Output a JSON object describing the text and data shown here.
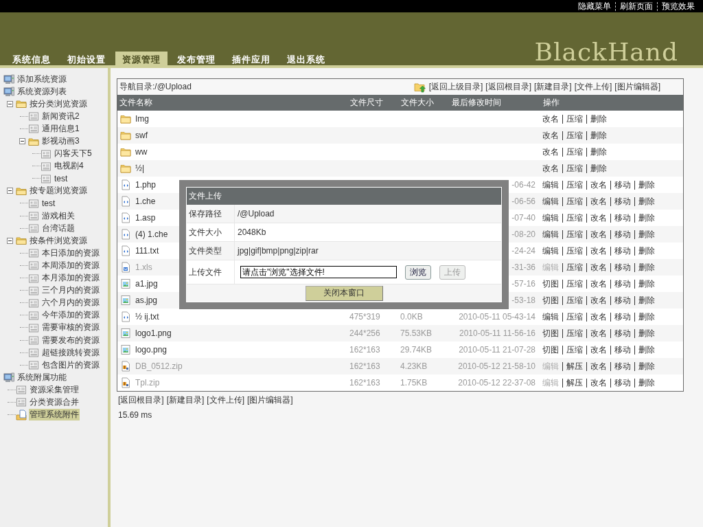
{
  "top_links": [
    "隐藏菜单",
    "刷新页面",
    "预览效果"
  ],
  "logo": "BlackHand",
  "tabs": [
    {
      "label": "系统信息",
      "selected": false
    },
    {
      "label": "初始设置",
      "selected": false
    },
    {
      "label": "资源管理",
      "selected": true
    },
    {
      "label": "发布管理",
      "selected": false
    },
    {
      "label": "插件应用",
      "selected": false
    },
    {
      "label": "退出系统",
      "selected": false
    }
  ],
  "sidebar": {
    "items": [
      {
        "label": "添加系统资源",
        "kind": "computer",
        "selected": false
      },
      {
        "label": "系统资源列表",
        "kind": "computer",
        "selected": false,
        "children": [
          {
            "label": "按分类浏览资源",
            "kind": "folder",
            "expanded": true,
            "selected": false,
            "children": [
              {
                "label": "新闻资讯2",
                "kind": "page",
                "selected": false
              },
              {
                "label": "通用信息1",
                "kind": "page",
                "selected": false
              },
              {
                "label": "影视动画3",
                "kind": "folder",
                "expanded": true,
                "selected": false,
                "children": [
                  {
                    "label": "闪客天下5",
                    "kind": "page",
                    "selected": false
                  },
                  {
                    "label": "电视剧4",
                    "kind": "page",
                    "selected": false
                  },
                  {
                    "label": "test",
                    "kind": "page",
                    "selected": false
                  }
                ]
              }
            ]
          },
          {
            "label": "按专题浏览资源",
            "kind": "folder",
            "expanded": true,
            "selected": false,
            "children": [
              {
                "label": "test",
                "kind": "page",
                "selected": false
              },
              {
                "label": "游戏相关",
                "kind": "page",
                "selected": false
              },
              {
                "label": "台湾话题",
                "kind": "page",
                "selected": false
              }
            ]
          },
          {
            "label": "按条件浏览资源",
            "kind": "folder",
            "expanded": true,
            "selected": false,
            "children": [
              {
                "label": "本日添加的资源",
                "kind": "page",
                "selected": false
              },
              {
                "label": "本周添加的资源",
                "kind": "page",
                "selected": false
              },
              {
                "label": "本月添加的资源",
                "kind": "page",
                "selected": false
              },
              {
                "label": "三个月内的资源",
                "kind": "page",
                "selected": false
              },
              {
                "label": "六个月内的资源",
                "kind": "page",
                "selected": false
              },
              {
                "label": "今年添加的资源",
                "kind": "page",
                "selected": false
              },
              {
                "label": "需要审核的资源",
                "kind": "page",
                "selected": false
              },
              {
                "label": "需要发布的资源",
                "kind": "page",
                "selected": false
              },
              {
                "label": "超链接跳转资源",
                "kind": "page",
                "selected": false
              },
              {
                "label": "包含图片的资源",
                "kind": "page",
                "selected": false
              }
            ]
          }
        ]
      },
      {
        "label": "系统附属功能",
        "kind": "computer",
        "selected": false,
        "children": [
          {
            "label": "资源采集管理",
            "kind": "page",
            "selected": false
          },
          {
            "label": "分类资源合并",
            "kind": "page",
            "selected": false
          },
          {
            "label": "管理系统附件",
            "kind": "attachment",
            "selected": true
          }
        ]
      }
    ]
  },
  "nav": {
    "path": "导航目录:/@Upload",
    "links": [
      "[返回上级目录]",
      "[返回根目录]",
      "[新建目录]",
      "[文件上传]",
      "[图片编辑器]"
    ]
  },
  "table": {
    "columns": [
      "文件名称",
      "文件尺寸",
      "文件大小",
      "最后修改时间",
      "操作"
    ],
    "rows": [
      {
        "kind": "folder",
        "name": "Img",
        "muted": false,
        "actions": [
          {
            "label": "改名",
            "disabled": false
          },
          {
            "label": "压缩",
            "disabled": false
          },
          {
            "label": "删除",
            "disabled": false
          }
        ]
      },
      {
        "kind": "folder",
        "name": "swf",
        "muted": false,
        "actions": [
          {
            "label": "改名",
            "disabled": false
          },
          {
            "label": "压缩",
            "disabled": false
          },
          {
            "label": "删除",
            "disabled": false
          }
        ]
      },
      {
        "kind": "folder",
        "name": "ww",
        "muted": false,
        "actions": [
          {
            "label": "改名",
            "disabled": false
          },
          {
            "label": "压缩",
            "disabled": false
          },
          {
            "label": "删除",
            "disabled": false
          }
        ]
      },
      {
        "kind": "folder",
        "name": "½|",
        "muted": false,
        "actions": [
          {
            "label": "改名",
            "disabled": false
          },
          {
            "label": "压缩",
            "disabled": false
          },
          {
            "label": "删除",
            "disabled": false
          }
        ]
      },
      {
        "kind": "code",
        "name": "1.php",
        "muted": false,
        "time": "-06-42",
        "actions": [
          {
            "label": "编辑",
            "disabled": false
          },
          {
            "label": "压缩",
            "disabled": false
          },
          {
            "label": "改名",
            "disabled": false
          },
          {
            "label": "移动",
            "disabled": false
          },
          {
            "label": "删除",
            "disabled": false
          }
        ]
      },
      {
        "kind": "code",
        "name": "1.che",
        "muted": false,
        "time": "-06-56",
        "actions": [
          {
            "label": "编辑",
            "disabled": false
          },
          {
            "label": "压缩",
            "disabled": false
          },
          {
            "label": "改名",
            "disabled": false
          },
          {
            "label": "移动",
            "disabled": false
          },
          {
            "label": "删除",
            "disabled": false
          }
        ]
      },
      {
        "kind": "code",
        "name": "1.asp",
        "muted": false,
        "time": "-07-40",
        "actions": [
          {
            "label": "编辑",
            "disabled": false
          },
          {
            "label": "压缩",
            "disabled": false
          },
          {
            "label": "改名",
            "disabled": false
          },
          {
            "label": "移动",
            "disabled": false
          },
          {
            "label": "删除",
            "disabled": false
          }
        ]
      },
      {
        "kind": "code",
        "name": "(4) 1.che",
        "muted": false,
        "time": "-08-20",
        "actions": [
          {
            "label": "编辑",
            "disabled": false
          },
          {
            "label": "压缩",
            "disabled": false
          },
          {
            "label": "改名",
            "disabled": false
          },
          {
            "label": "移动",
            "disabled": false
          },
          {
            "label": "删除",
            "disabled": false
          }
        ]
      },
      {
        "kind": "code",
        "name": "111.txt",
        "muted": false,
        "time": "-24-24",
        "actions": [
          {
            "label": "编辑",
            "disabled": false
          },
          {
            "label": "压缩",
            "disabled": false
          },
          {
            "label": "改名",
            "disabled": false
          },
          {
            "label": "移动",
            "disabled": false
          },
          {
            "label": "删除",
            "disabled": false
          }
        ]
      },
      {
        "kind": "word",
        "name": "1.xls",
        "muted": true,
        "time": "-31-36",
        "actions": [
          {
            "label": "编辑",
            "disabled": true
          },
          {
            "label": "压缩",
            "disabled": false
          },
          {
            "label": "改名",
            "disabled": false
          },
          {
            "label": "移动",
            "disabled": false
          },
          {
            "label": "删除",
            "disabled": false
          }
        ]
      },
      {
        "kind": "image",
        "name": "a1.jpg",
        "muted": false,
        "time": "-57-16",
        "actions": [
          {
            "label": "切图",
            "disabled": false
          },
          {
            "label": "压缩",
            "disabled": false
          },
          {
            "label": "改名",
            "disabled": false
          },
          {
            "label": "移动",
            "disabled": false
          },
          {
            "label": "删除",
            "disabled": false
          }
        ]
      },
      {
        "kind": "image",
        "name": "as.jpg",
        "muted": false,
        "time": "-53-18",
        "actions": [
          {
            "label": "切图",
            "disabled": false
          },
          {
            "label": "压缩",
            "disabled": false
          },
          {
            "label": "改名",
            "disabled": false
          },
          {
            "label": "移动",
            "disabled": false
          },
          {
            "label": "删除",
            "disabled": false
          }
        ]
      },
      {
        "kind": "code",
        "name": "½ ij.txt",
        "muted": false,
        "dimensions": "475*319",
        "size": "0.0KB",
        "time": "2010-05-11 05-43-14",
        "actions": [
          {
            "label": "编辑",
            "disabled": false
          },
          {
            "label": "压缩",
            "disabled": false
          },
          {
            "label": "改名",
            "disabled": false
          },
          {
            "label": "移动",
            "disabled": false
          },
          {
            "label": "删除",
            "disabled": false
          }
        ]
      },
      {
        "kind": "image",
        "name": "logo1.png",
        "muted": false,
        "dimensions": "244*256",
        "size": "75.53KB",
        "time": "2010-05-11 11-56-16",
        "actions": [
          {
            "label": "切图",
            "disabled": false
          },
          {
            "label": "压缩",
            "disabled": false
          },
          {
            "label": "改名",
            "disabled": false
          },
          {
            "label": "移动",
            "disabled": false
          },
          {
            "label": "删除",
            "disabled": false
          }
        ]
      },
      {
        "kind": "image",
        "name": "logo.png",
        "muted": false,
        "dimensions": "162*163",
        "size": "29.74KB",
        "time": "2010-05-11 21-07-28",
        "actions": [
          {
            "label": "切图",
            "disabled": false
          },
          {
            "label": "压缩",
            "disabled": false
          },
          {
            "label": "改名",
            "disabled": false
          },
          {
            "label": "移动",
            "disabled": false
          },
          {
            "label": "删除",
            "disabled": false
          }
        ]
      },
      {
        "kind": "zip",
        "name": "DB_0512.zip",
        "muted": true,
        "dimensions": "162*163",
        "size": "4.23KB",
        "time": "2010-05-12 21-58-10",
        "actions": [
          {
            "label": "编辑",
            "disabled": true
          },
          {
            "label": "解压",
            "disabled": false
          },
          {
            "label": "改名",
            "disabled": false
          },
          {
            "label": "移动",
            "disabled": false
          },
          {
            "label": "删除",
            "disabled": false
          }
        ]
      },
      {
        "kind": "zip",
        "name": "Tpl.zip",
        "muted": true,
        "dimensions": "162*163",
        "size": "1.75KB",
        "time": "2010-05-12 22-37-08",
        "actions": [
          {
            "label": "编辑",
            "disabled": true
          },
          {
            "label": "解压",
            "disabled": false
          },
          {
            "label": "改名",
            "disabled": false
          },
          {
            "label": "移动",
            "disabled": false
          },
          {
            "label": "删除",
            "disabled": false
          }
        ]
      }
    ]
  },
  "bottom_links": [
    "[返回根目录]",
    "[新建目录]",
    "[文件上传]",
    "[图片编辑器]"
  ],
  "timing": "15.69 ms",
  "upload_dialog": {
    "title": "文件上传",
    "fields": [
      {
        "label": "保存路径",
        "value": "/@Upload"
      },
      {
        "label": "文件大小",
        "value": "2048Kb"
      },
      {
        "label": "文件类型",
        "value": "jpg|gif|bmp|png|zip|rar"
      }
    ],
    "file_label": "上传文件",
    "file_value": "请点击\"浏览\"选择文件!",
    "buttons": [
      {
        "label": "浏览",
        "disabled": false
      },
      {
        "label": "上传",
        "disabled": true
      }
    ],
    "close": "关闭本窗口"
  }
}
